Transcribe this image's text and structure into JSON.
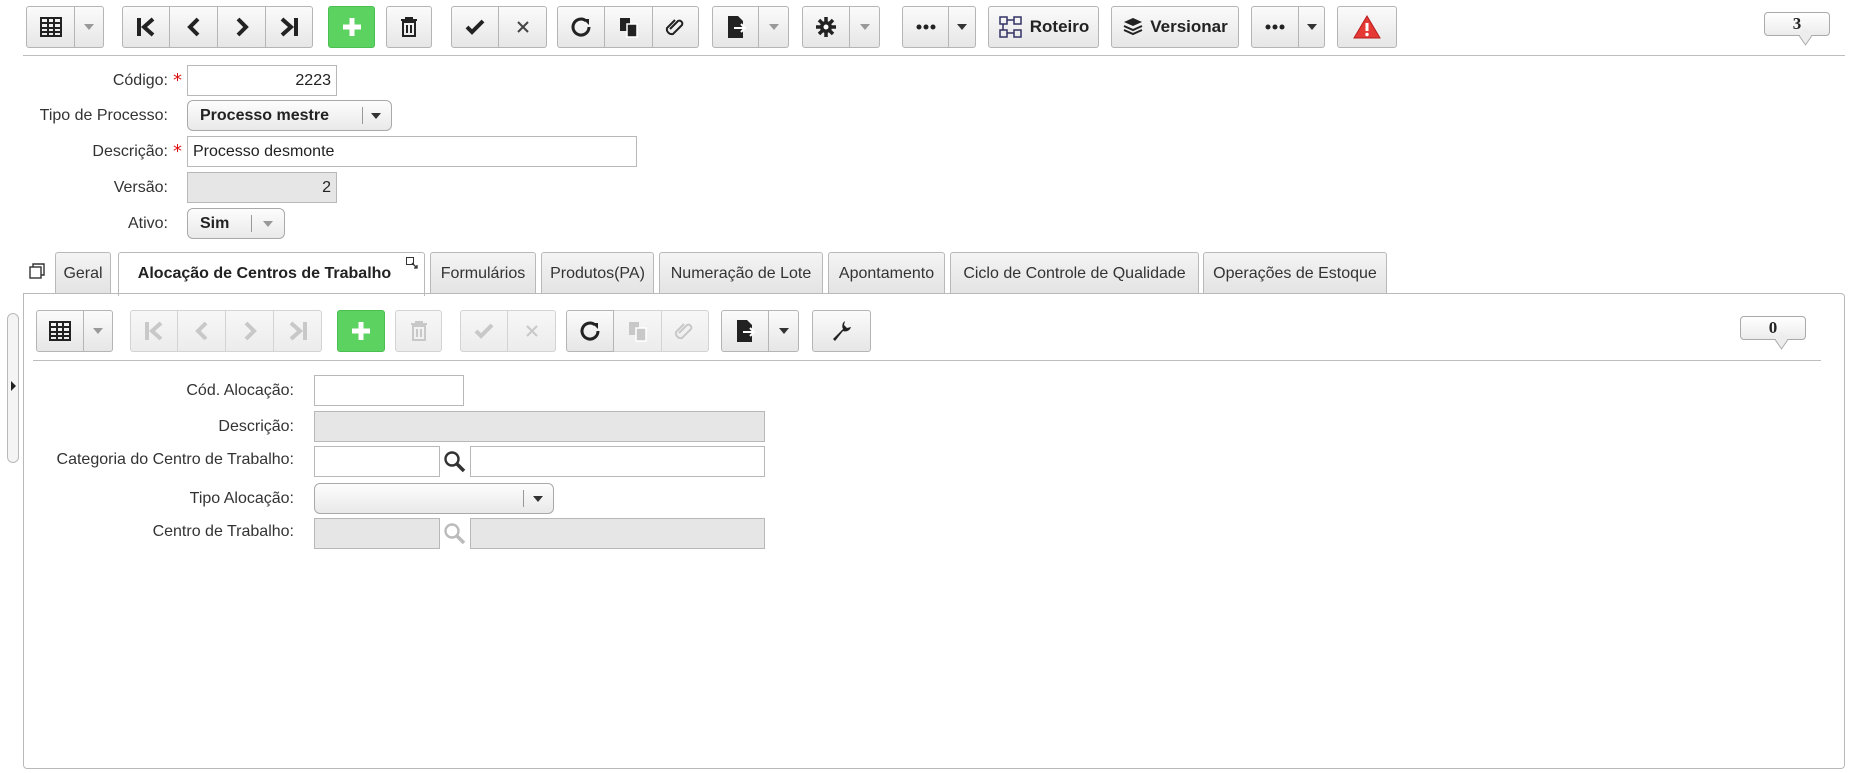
{
  "toolbar": {
    "roteiro_label": "Roteiro",
    "versionar_label": "Versionar",
    "record_count": "3"
  },
  "form": {
    "codigo": {
      "label": "Código:",
      "value": "2223"
    },
    "tipo_processo": {
      "label": "Tipo de Processo:",
      "value": "Processo mestre"
    },
    "descricao": {
      "label": "Descrição:",
      "value": "Processo desmonte"
    },
    "versao": {
      "label": "Versão:",
      "value": "2"
    },
    "ativo": {
      "label": "Ativo:",
      "value": "Sim"
    },
    "required_mark": "*"
  },
  "tabs": [
    {
      "label": "Geral"
    },
    {
      "label": "Alocação de Centros de Trabalho"
    },
    {
      "label": "Formulários"
    },
    {
      "label": "Produtos(PA)"
    },
    {
      "label": "Numeração de Lote"
    },
    {
      "label": "Apontamento"
    },
    {
      "label": "Ciclo de Controle de Qualidade"
    },
    {
      "label": "Operações de Estoque"
    }
  ],
  "subpanel": {
    "record_count": "0",
    "cod_alocacao": {
      "label": "Cód. Alocação:",
      "value": ""
    },
    "descricao": {
      "label": "Descrição:",
      "value": ""
    },
    "categoria": {
      "label": "Categoria do Centro de Trabalho:",
      "code": "",
      "name": ""
    },
    "tipo_alocacao": {
      "label": "Tipo Alocação:",
      "value": ""
    },
    "centro_trabalho": {
      "label": "Centro de Trabalho:",
      "code": "",
      "name": ""
    }
  },
  "colors": {
    "green_button": "#5cd261",
    "required": "#d11111",
    "alert": "#e53935"
  }
}
